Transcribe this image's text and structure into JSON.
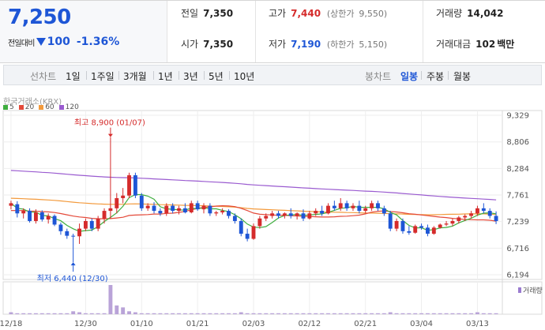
{
  "quote": {
    "price": "7,250",
    "change_label": "전일대비",
    "change_amount": "100",
    "change_percent": "-1.36%",
    "colors": {
      "up": "#d52b2b",
      "down": "#1e56d6"
    }
  },
  "stats": {
    "prev_close": {
      "label": "전일",
      "value": "7,350"
    },
    "open": {
      "label": "시가",
      "value": "7,350"
    },
    "high": {
      "label": "고가",
      "value": "7,440",
      "limit_label": "(상한가",
      "limit_value": "9,550)"
    },
    "low": {
      "label": "저가",
      "value": "7,190",
      "limit_label": "(하한가",
      "limit_value": "5,150)"
    },
    "volume": {
      "label": "거래량",
      "value": "14,042"
    },
    "turnover": {
      "label": "거래대금",
      "value": "102",
      "unit": "백만"
    }
  },
  "period_tabs": {
    "line_label": "선차트",
    "line_items": [
      "1일",
      "1주일",
      "3개월",
      "1년",
      "3년",
      "5년",
      "10년"
    ],
    "candle_label": "봉차트",
    "candle_items": [
      "일봉",
      "주봉",
      "월봉"
    ],
    "selected": "일봉"
  },
  "chart_data": {
    "type": "candlestick",
    "source": "한국거래소(KRX)",
    "moving_averages": [
      {
        "name": "5",
        "color": "#3fae3f"
      },
      {
        "name": "20",
        "color": "#e44a3a"
      },
      {
        "name": "60",
        "color": "#f39a3c"
      },
      {
        "name": "120",
        "color": "#9a5bd0"
      }
    ],
    "y_ticks": [
      "9,329",
      "8,806",
      "8,284",
      "7,761",
      "7,239",
      "6,716",
      "6,194"
    ],
    "y_tick_values": [
      9329,
      8806,
      8284,
      7761,
      7239,
      6716,
      6194
    ],
    "x_ticks": [
      "12/18",
      "12/30",
      "01/10",
      "01/21",
      "02/03",
      "02/12",
      "02/21",
      "03/04",
      "03/13"
    ],
    "x_tick_index": [
      0,
      12,
      21,
      30,
      39,
      48,
      57,
      66,
      75
    ],
    "annotations": {
      "max_label": "최고 8,900 (01/07)",
      "max_index": 16,
      "max_value": 8900,
      "min_label": "최저 6,440 (12/30)",
      "min_index": 10,
      "min_value": 6440
    },
    "volume_legend": "거래량",
    "candles": [
      [
        7550,
        7650,
        7480,
        7600
      ],
      [
        7580,
        7640,
        7320,
        7400
      ],
      [
        7400,
        7500,
        7300,
        7450
      ],
      [
        7450,
        7500,
        7220,
        7250
      ],
      [
        7250,
        7480,
        7200,
        7420
      ],
      [
        7420,
        7460,
        7240,
        7280
      ],
      [
        7280,
        7400,
        7200,
        7350
      ],
      [
        7350,
        7380,
        7150,
        7180
      ],
      [
        7180,
        7220,
        6980,
        7050
      ],
      [
        7050,
        7100,
        6900,
        6960
      ],
      [
        6960,
        7000,
        6440,
        6950
      ],
      [
        6950,
        7200,
        6800,
        7100
      ],
      [
        7100,
        7300,
        7050,
        7250
      ],
      [
        7250,
        7300,
        7050,
        7100
      ],
      [
        7100,
        7350,
        7050,
        7300
      ],
      [
        7300,
        7500,
        7200,
        7450
      ],
      [
        7450,
        8900,
        7300,
        7500
      ],
      [
        7500,
        7800,
        7400,
        7700
      ],
      [
        7700,
        7900,
        7600,
        7750
      ],
      [
        7750,
        8200,
        7700,
        8150
      ],
      [
        8150,
        8200,
        7700,
        7750
      ],
      [
        7750,
        7800,
        7450,
        7500
      ],
      [
        7500,
        7600,
        7450,
        7550
      ],
      [
        7550,
        7620,
        7400,
        7450
      ],
      [
        7450,
        7500,
        7350,
        7400
      ],
      [
        7400,
        7600,
        7350,
        7550
      ],
      [
        7550,
        7600,
        7400,
        7450
      ],
      [
        7450,
        7550,
        7380,
        7500
      ],
      [
        7500,
        7600,
        7400,
        7420
      ],
      [
        7420,
        7650,
        7400,
        7600
      ],
      [
        7600,
        7650,
        7450,
        7480
      ],
      [
        7480,
        7600,
        7400,
        7550
      ],
      [
        7550,
        7600,
        7350,
        7400
      ],
      [
        7400,
        7450,
        7350,
        7420
      ],
      [
        7420,
        7500,
        7380,
        7450
      ],
      [
        7450,
        7480,
        7300,
        7350
      ],
      [
        7350,
        7400,
        7200,
        7250
      ],
      [
        7250,
        7300,
        6950,
        7000
      ],
      [
        7000,
        7100,
        6850,
        6900
      ],
      [
        6900,
        7200,
        6880,
        7150
      ],
      [
        7150,
        7350,
        7100,
        7300
      ],
      [
        7300,
        7400,
        7250,
        7350
      ],
      [
        7350,
        7450,
        7300,
        7400
      ],
      [
        7400,
        7450,
        7300,
        7350
      ],
      [
        7350,
        7420,
        7300,
        7400
      ],
      [
        7400,
        7500,
        7300,
        7350
      ],
      [
        7350,
        7420,
        7280,
        7400
      ],
      [
        7400,
        7480,
        7250,
        7300
      ],
      [
        7300,
        7450,
        7280,
        7400
      ],
      [
        7400,
        7500,
        7350,
        7450
      ],
      [
        7450,
        7550,
        7350,
        7400
      ],
      [
        7400,
        7600,
        7380,
        7550
      ],
      [
        7550,
        7650,
        7450,
        7500
      ],
      [
        7500,
        7700,
        7450,
        7600
      ],
      [
        7600,
        7650,
        7450,
        7500
      ],
      [
        7500,
        7600,
        7450,
        7550
      ],
      [
        7550,
        7650,
        7400,
        7450
      ],
      [
        7450,
        7550,
        7400,
        7500
      ],
      [
        7500,
        7650,
        7450,
        7600
      ],
      [
        7600,
        7650,
        7450,
        7500
      ],
      [
        7500,
        7550,
        7350,
        7400
      ],
      [
        7400,
        7450,
        7050,
        7100
      ],
      [
        7100,
        7300,
        7050,
        7250
      ],
      [
        7250,
        7300,
        7000,
        7050
      ],
      [
        7050,
        7150,
        6980,
        7020
      ],
      [
        7020,
        7180,
        7000,
        7150
      ],
      [
        7150,
        7200,
        7080,
        7120
      ],
      [
        7120,
        7180,
        6950,
        7000
      ],
      [
        7000,
        7150,
        6980,
        7120
      ],
      [
        7120,
        7200,
        7100,
        7180
      ],
      [
        7180,
        7250,
        7150,
        7200
      ],
      [
        7200,
        7300,
        7150,
        7250
      ],
      [
        7250,
        7350,
        7200,
        7320
      ],
      [
        7320,
        7380,
        7250,
        7350
      ],
      [
        7350,
        7450,
        7300,
        7400
      ],
      [
        7400,
        7550,
        7350,
        7500
      ],
      [
        7500,
        7600,
        7400,
        7450
      ],
      [
        7450,
        7500,
        7300,
        7350
      ],
      [
        7350,
        7440,
        7190,
        7250
      ]
    ],
    "volumes": [
      2,
      1,
      1,
      1,
      1,
      1,
      1,
      1,
      1,
      1,
      3,
      2,
      1,
      1,
      1,
      1,
      30,
      9,
      7,
      3,
      2,
      1,
      1,
      1,
      1,
      1,
      1,
      1,
      1,
      1,
      1,
      1,
      1,
      1,
      1,
      1,
      1,
      2,
      1,
      1,
      1,
      1,
      1,
      1,
      1,
      1,
      1,
      1,
      1,
      1,
      1,
      1,
      1,
      1,
      1,
      1,
      1,
      1,
      1,
      1,
      1,
      2,
      1,
      1,
      1,
      1,
      1,
      1,
      1,
      1,
      1,
      1,
      1,
      1,
      1,
      2,
      1,
      1,
      1
    ]
  }
}
